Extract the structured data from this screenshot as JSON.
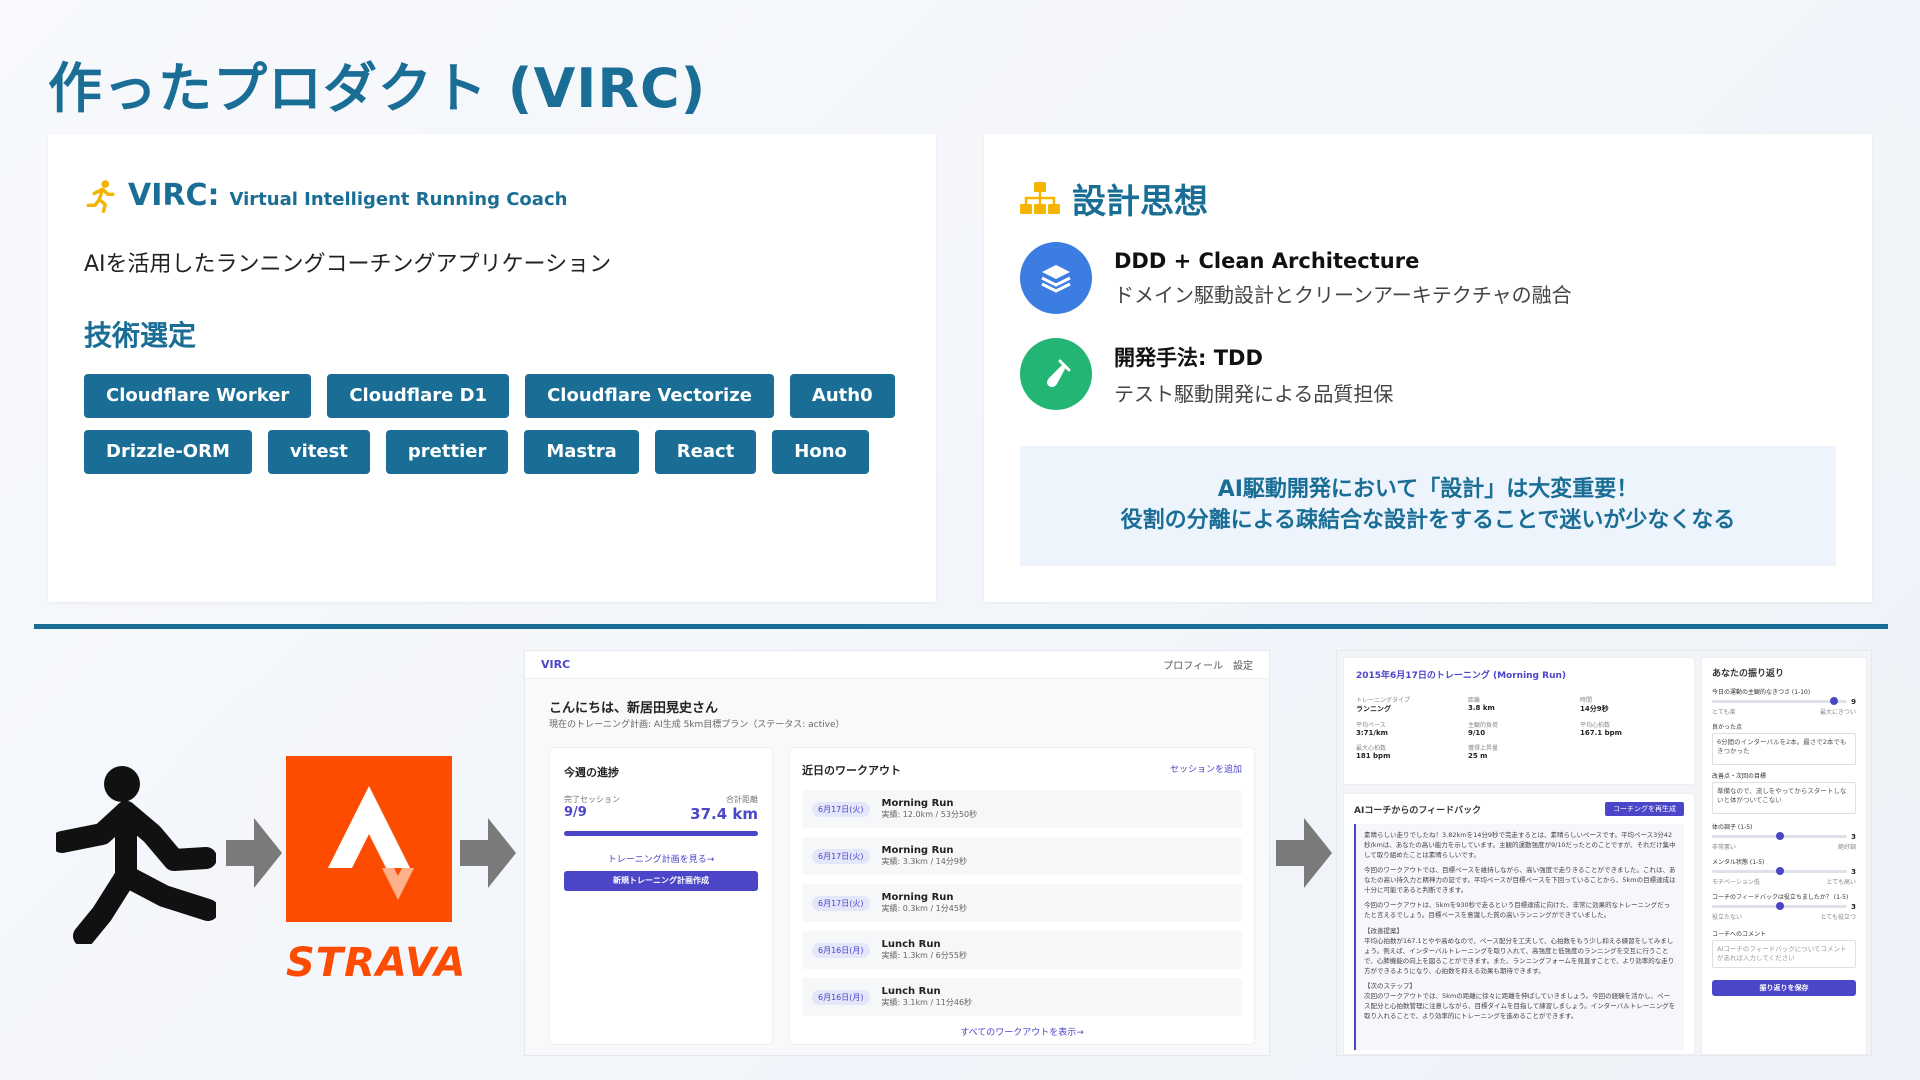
{
  "page": {
    "title": "作ったプロダクト (VIRC)"
  },
  "virc": {
    "name": "VIRC:",
    "full_name": "Virtual Intelligent Running Coach",
    "description": "AIを活用したランニングコーチングアプリケーション",
    "tech_title": "技術選定",
    "tags_row1": [
      "Cloudflare Worker",
      "Cloudflare D1",
      "Cloudflare Vectorize",
      "Auth0"
    ],
    "tags_row2": [
      "Drizzle-ORM",
      "vitest",
      "prettier",
      "Mastra",
      "React",
      "Hono"
    ]
  },
  "design": {
    "title": "設計思想",
    "principles": [
      {
        "title": "DDD + Clean Architecture",
        "sub": "ドメイン駆動設計とクリーンアーキテクチャの融合",
        "color": "#3b7de0"
      },
      {
        "title": "開発手法: TDD",
        "sub": "テスト駆動開発による品質担保",
        "color": "#22b573"
      }
    ],
    "callout_line1": "AI駆動開発において「設計」は大変重要！",
    "callout_line2": "役割の分離による疎結合な設計をすることで迷いが少なくなる"
  },
  "flow": {
    "strava_label": "STRAVA"
  },
  "app_home": {
    "brand": "VIRC",
    "nav": "プロフィール　設定",
    "greeting": "こんにちは、新居田晃史さん",
    "plan": "現在のトレーニング計画: AI生成 5km目標プラン（ステータス: active）",
    "weekly": {
      "title": "今週の進捗",
      "sessions_label": "完了セッション",
      "sessions_value": "9/9",
      "distance_label": "合計距離",
      "distance_value": "37.4 km",
      "progress": 1.0,
      "link": "トレーニング計画を見る→",
      "button": "新規トレーニング計画作成"
    },
    "workouts": {
      "title": "近日のワークアウト",
      "add_link": "セッションを追加",
      "items": [
        {
          "date": "6月17日(火)",
          "name": "Morning Run",
          "detail": "実績: 12.0km / 53分50秒"
        },
        {
          "date": "6月17日(火)",
          "name": "Morning Run",
          "detail": "実績: 3.3km / 14分9秒"
        },
        {
          "date": "6月17日(火)",
          "name": "Morning Run",
          "detail": "実績: 0.3km / 1分45秒"
        },
        {
          "date": "6月16日(月)",
          "name": "Lunch Run",
          "detail": "実績: 1.3km / 6分55秒"
        },
        {
          "date": "6月16日(月)",
          "name": "Lunch Run",
          "detail": "実績: 3.1km / 11分46秒"
        }
      ],
      "all_link": "すべてのワークアウトを表示→"
    }
  },
  "app_detail": {
    "header": "2015年6月17日のトレーニング (Morning Run)",
    "stats": [
      {
        "label": "トレーニングタイプ",
        "value": "ランニング"
      },
      {
        "label": "距離",
        "value": "3.8 km"
      },
      {
        "label": "時間",
        "value": "14分9秒"
      },
      {
        "label": "平均ペース",
        "value": "3:71/km"
      },
      {
        "label": "主観的負荷",
        "value": "9/10"
      },
      {
        "label": "平均心拍数",
        "value": "167.1 bpm"
      },
      {
        "label": "最大心拍数",
        "value": "181 bpm"
      },
      {
        "label": "獲得上昇量",
        "value": "25 m"
      }
    ],
    "feedback_title": "AIコーチからのフィードバック",
    "feedback_button": "コーチングを再生成",
    "feedback_paragraphs": [
      "素晴らしい走りでしたね！3.82kmを14分9秒で完走するとは、素晴らしいペースです。平均ペース3分42秒/kmは、あなたの高い能力を示しています。主観的運動強度が9/10だったとのことですが、それだけ集中して取り組めたことは素晴らしいです。",
      "今回のワークアウトでは、目標ペースを維持しながら、高い強度で走りきることができました。これは、あなたの高い持久力と精神力の証です。平均ペースが目標ペースを下回っていることから、5kmの目標達成は十分に可能であると判断できます。",
      "今回のワークアウトは、5kmを930秒で走るという目標達成に向けた、非常に効果的なトレーニングだったと言えるでしょう。目標ペースを意識した質の高いランニングができていました。",
      "【改善提案】",
      "平均心拍数が167.1とやや高めなので、ペース配分を工夫して、心拍数をもう少し抑える練習をしてみましょう。例えば、インターバルトレーニングを取り入れて、高強度と低強度のランニングを交互に行うことで、心肺機能の向上を図ることができます。また、ランニングフォームを見直すことで、より効率的な走り方ができるようになり、心拍数を抑える効果も期待できます。",
      "【次のステップ】",
      "次回のワークアウトでは、5kmの距離に徐々に距離を伸ばしていきましょう。今回の経験を活かし、ペース配分と心拍数管理に注意しながら、目標タイムを目指して練習しましょう。インターバルトレーニングを取り入れることで、より効率的にトレーニングを進めることができます。"
    ],
    "reflection": {
      "title": "あなたの振り返り",
      "effort_label": "今日の運動の主観的なきつさ (1-10)",
      "effort_value": "9",
      "effort_level": 0.9,
      "effort_min": "とても楽",
      "effort_max": "最大にきつい",
      "good_label": "良かった点",
      "good_value": "6分間のインターバルを2本。最さで2本でもきつかった",
      "improve_label": "改善点・次回の目標",
      "improve_value": "準備なので、流しをやってからスタートしないと体がついてこない",
      "body_label": "体の調子 (1-5)",
      "body_value": "3",
      "body_level": 0.5,
      "body_min": "非常悪い",
      "body_max": "絶好調",
      "mental_label": "メンタル状態 (1-5)",
      "mental_value": "3",
      "mental_level": 0.5,
      "mental_min": "モチベーション低",
      "mental_max": "とても高い",
      "useful_label": "コーチのフィードバックは役立ちましたか？ (1-5)",
      "useful_value": "3",
      "useful_level": 0.5,
      "useful_min": "役立たない",
      "useful_max": "とても役立つ",
      "comment_label": "コーチへのコメント",
      "comment_placeholder": "AIコーチのフィードバックについてコメントがあれば入力してください",
      "save_button": "振り返りを保存"
    }
  }
}
